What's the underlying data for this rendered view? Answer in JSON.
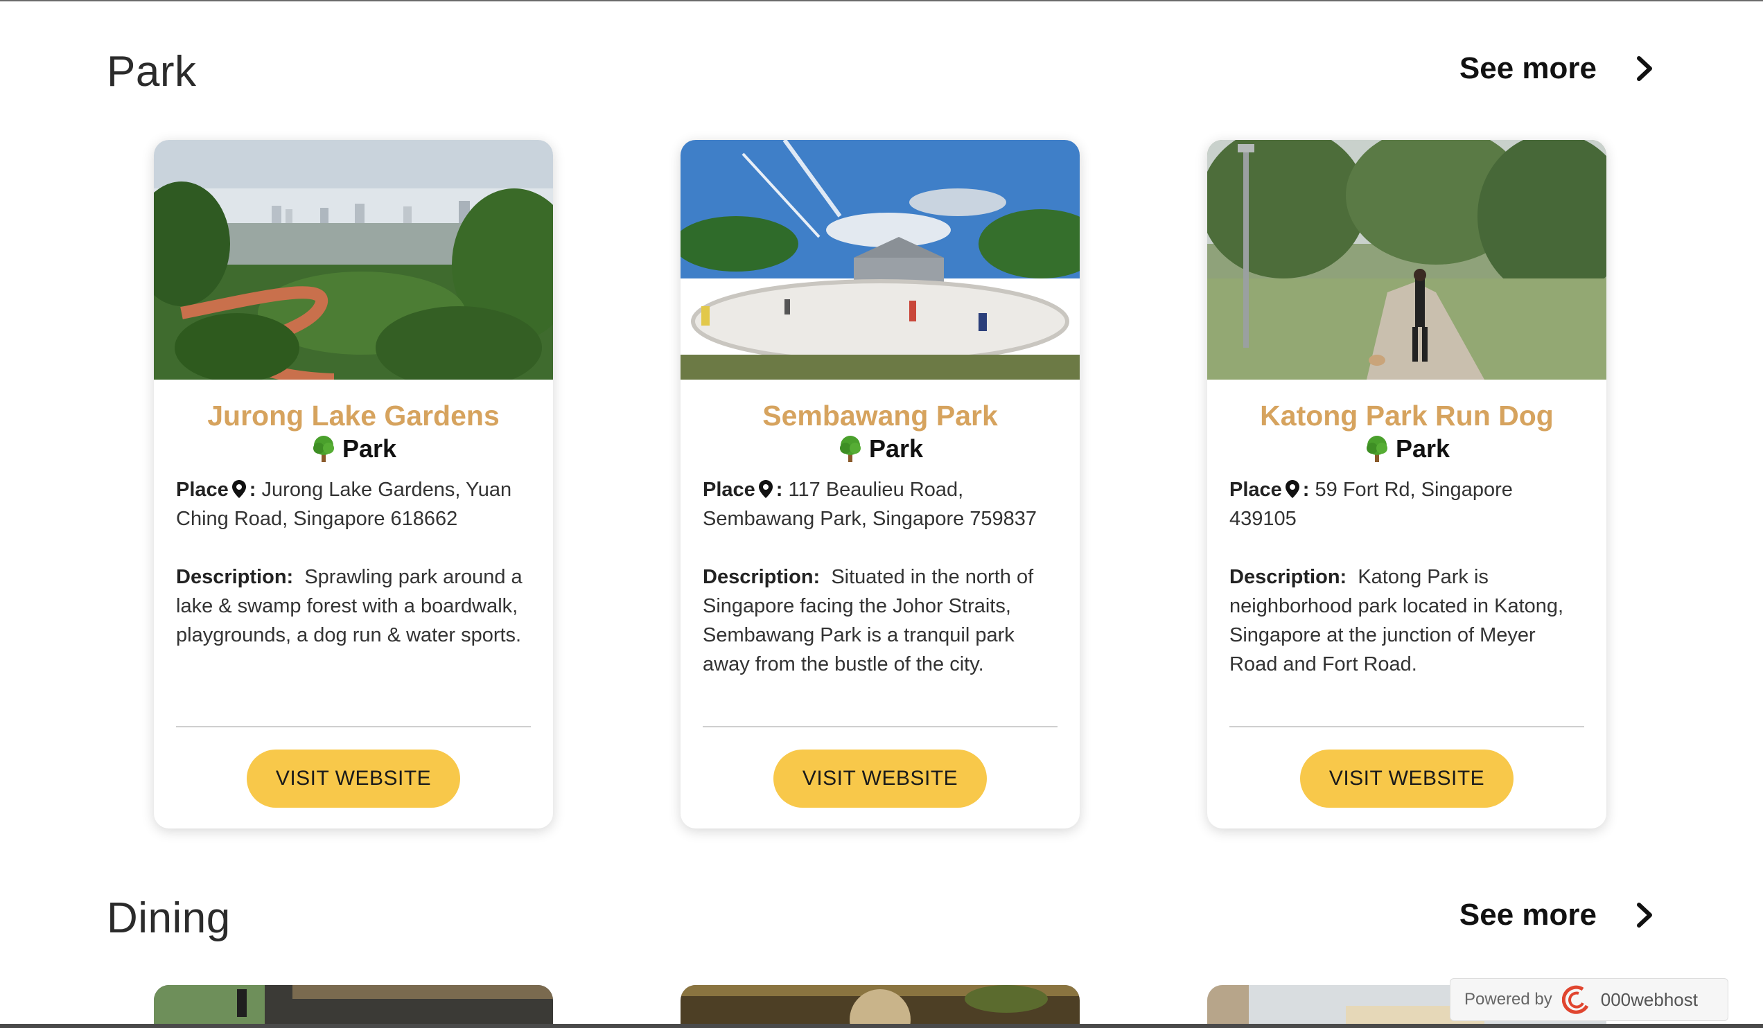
{
  "sections": [
    {
      "title": "Park",
      "see_more": "See more",
      "cards": [
        {
          "title": "Jurong Lake Gardens",
          "category": "Park",
          "place_label": "Place",
          "place_sep": ":",
          "place_value": "Jurong Lake Gardens, Yuan Ching Road, Singapore 618662",
          "desc_label": "Description:",
          "desc_value": "Sprawling park around a lake & swamp forest with a boardwalk, playgrounds, a dog run & water sports.",
          "button": "VISIT WEBSITE"
        },
        {
          "title": "Sembawang Park",
          "category": "Park",
          "place_label": "Place",
          "place_sep": ":",
          "place_value": "117 Beaulieu Road, Sembawang Park, Singapore 759837",
          "desc_label": "Description:",
          "desc_value": "Situated in the north of Singapore facing the Johor Straits, Sembawang Park is a tranquil park away from the bustle of the city.",
          "button": "VISIT WEBSITE"
        },
        {
          "title": "Katong Park Run Dog",
          "category": "Park",
          "place_label": "Place",
          "place_sep": ":",
          "place_value": "59 Fort Rd, Singapore 439105",
          "desc_label": "Description:",
          "desc_value": "Katong Park is neighborhood park located in Katong, Singapore at the junction of Meyer Road and Fort Road.",
          "button": "VISIT WEBSITE"
        }
      ]
    },
    {
      "title": "Dining",
      "see_more": "See more"
    }
  ],
  "footer_badge": {
    "powered_by": "Powered by",
    "host": "000webhost"
  },
  "colors": {
    "card_title": "#d6a35e",
    "button_bg": "#f8c84a",
    "heading": "#2b2b2b"
  },
  "icons": [
    "chevron-right-icon",
    "tree-icon",
    "map-pin-icon",
    "000webhost-logo-icon"
  ]
}
